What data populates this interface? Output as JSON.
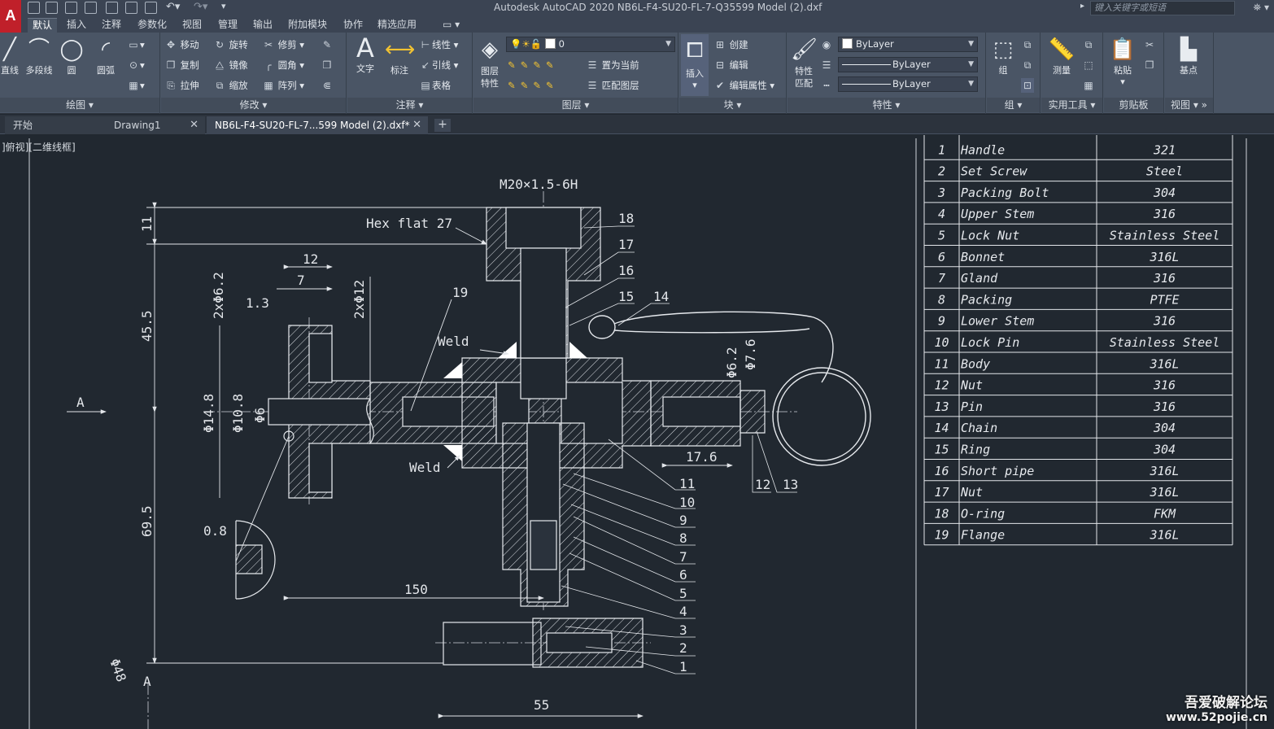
{
  "titlebar": {
    "title": "Autodesk AutoCAD 2020    NB6L-F4-SU20-FL-7-Q35599 Model (2).dxf",
    "search_placeholder": "键入关键字或短语"
  },
  "ribbon_tabs": [
    "默认",
    "插入",
    "注释",
    "参数化",
    "视图",
    "管理",
    "输出",
    "附加模块",
    "协作",
    "精选应用"
  ],
  "ribbon": {
    "draw": {
      "title": "绘图",
      "line": "直线",
      "polyline": "多段线",
      "circle": "圆",
      "arc": "圆弧"
    },
    "modify": {
      "title": "修改",
      "move": "移动",
      "rotate": "旋转",
      "trim": "修剪",
      "copy": "复制",
      "mirror": "镜像",
      "fillet": "圆角",
      "stretch": "拉伸",
      "scale": "缩放",
      "array": "阵列"
    },
    "annotation": {
      "title": "注释",
      "text": "文字",
      "dimension": "标注",
      "linear": "线性",
      "leader": "引线",
      "table": "表格"
    },
    "layers": {
      "title": "图层",
      "properties": "图层\n特性",
      "layer_value": "0",
      "set_current": "置为当前",
      "match_layer": "匹配图层"
    },
    "block": {
      "title": "块",
      "insert": "插入",
      "create": "创建",
      "edit": "编辑",
      "edit_attr": "编辑属性"
    },
    "properties": {
      "title": "特性",
      "match": "特性\n匹配",
      "color": "ByLayer",
      "linetype": "ByLayer",
      "lineweight": "ByLayer"
    },
    "groups": {
      "title": "组",
      "group": "组"
    },
    "utilities": {
      "title": "实用工具",
      "measure": "测量"
    },
    "clipboard": {
      "title": "剪贴板",
      "paste": "粘贴"
    },
    "view": {
      "title": "视图",
      "base": "基点"
    }
  },
  "doc_tabs": [
    {
      "label": "开始"
    },
    {
      "label": "Drawing1"
    },
    {
      "label": "NB6L-F4-SU20-FL-7...599 Model (2).dxf*"
    }
  ],
  "view_label": "]俯视][二维线框]",
  "drawing": {
    "notes": {
      "thread": "M20×1.5-6H",
      "hex": "Hex flat 27",
      "weld1": "Weld",
      "weld2": "Weld",
      "view_a1": "A",
      "view_a2": "A"
    },
    "dims": [
      "11",
      "45.5",
      "69.5",
      "12",
      "7",
      "1.3",
      "2xΦ6.2",
      "2xΦ12",
      "Φ14.8",
      "Φ10.8",
      "Φ6",
      "0.8",
      "150",
      "55",
      "17.6",
      "Φ6.2",
      "Φ7.6",
      "Φ48"
    ],
    "balloons": [
      "18",
      "17",
      "16",
      "15",
      "14",
      "19",
      "11",
      "10",
      "9",
      "8",
      "7",
      "6",
      "5",
      "4",
      "3",
      "2",
      "1",
      "12",
      "13"
    ]
  },
  "bom": [
    {
      "no": "1",
      "name": "Handle",
      "material": "321"
    },
    {
      "no": "2",
      "name": "Set Screw",
      "material": "Steel"
    },
    {
      "no": "3",
      "name": "Packing Bolt",
      "material": "304"
    },
    {
      "no": "4",
      "name": "Upper Stem",
      "material": "316"
    },
    {
      "no": "5",
      "name": "Lock Nut",
      "material": "Stainless Steel"
    },
    {
      "no": "6",
      "name": "Bonnet",
      "material": "316L"
    },
    {
      "no": "7",
      "name": "Gland",
      "material": "316"
    },
    {
      "no": "8",
      "name": "Packing",
      "material": "PTFE"
    },
    {
      "no": "9",
      "name": "Lower Stem",
      "material": "316"
    },
    {
      "no": "10",
      "name": "Lock Pin",
      "material": "Stainless Steel"
    },
    {
      "no": "11",
      "name": "Body",
      "material": "316L"
    },
    {
      "no": "12",
      "name": "Nut",
      "material": "316"
    },
    {
      "no": "13",
      "name": "Pin",
      "material": "316"
    },
    {
      "no": "14",
      "name": "Chain",
      "material": "304"
    },
    {
      "no": "15",
      "name": "Ring",
      "material": "304"
    },
    {
      "no": "16",
      "name": "Short pipe",
      "material": "316L"
    },
    {
      "no": "17",
      "name": "Nut",
      "material": "316L"
    },
    {
      "no": "18",
      "name": "O-ring",
      "material": "FKM"
    },
    {
      "no": "19",
      "name": "Flange",
      "material": "316L"
    }
  ],
  "watermark": {
    "line1": "吾爱破解论坛",
    "line2": "www.52pojie.cn"
  }
}
